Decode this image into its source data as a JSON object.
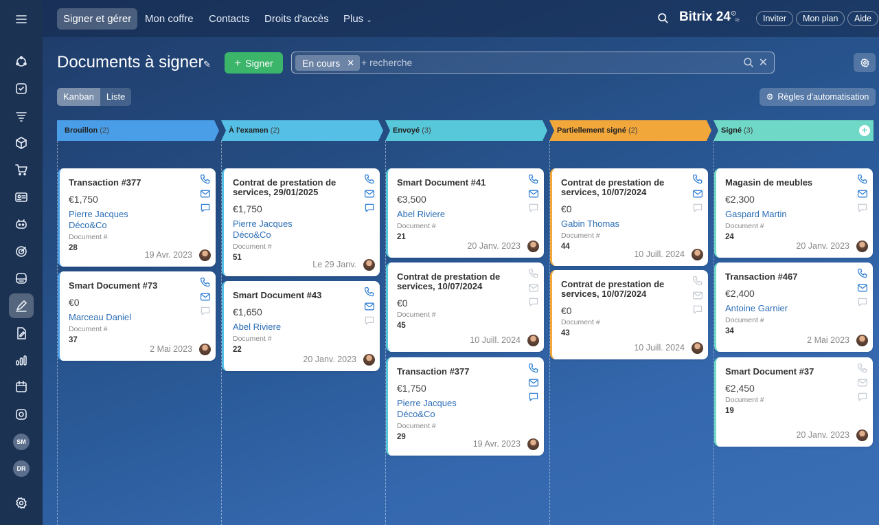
{
  "topnav": {
    "items": [
      "Signer et gérer",
      "Mon coffre",
      "Contacts",
      "Droits d'accès",
      "Plus"
    ],
    "brand": "Bitrix 24",
    "brand_sup": "⊙",
    "invite": "Inviter",
    "plan": "Mon plan",
    "help": "Aide"
  },
  "sidebar": {
    "avatars": [
      "SM",
      "DR"
    ]
  },
  "page": {
    "title": "Documents à signer",
    "sign_button": "Signer",
    "filter_chip": "En cours",
    "search_placeholder": "+ recherche",
    "view_kanban": "Kanban",
    "view_list": "Liste",
    "automation_button": "Règles d'automatisation"
  },
  "columns": [
    {
      "name": "Brouillon",
      "count": "(2)",
      "color": "#4a9ee8"
    },
    {
      "name": "À l'examen",
      "count": "(2)",
      "color": "#55bfe6"
    },
    {
      "name": "Envoyé",
      "count": "(3)",
      "color": "#57c8da"
    },
    {
      "name": "Partiellement signé",
      "count": "(2)",
      "color": "#f2a73b"
    },
    {
      "name": "Signé",
      "count": "(3)",
      "color": "#6fd8c6"
    }
  ],
  "cards": {
    "c0_0": {
      "title": "Transaction #377",
      "amount": "€1,750",
      "link1": "Pierre Jacques",
      "link2": "Déco&Co",
      "meta": "Document #",
      "num": "28",
      "date": "19 Avr. 2023"
    },
    "c0_1": {
      "title": "Smart Document #73",
      "amount": "€0",
      "link1": "Marceau Daniel",
      "meta": "Document #",
      "num": "37",
      "date": "2 Mai 2023"
    },
    "c1_0": {
      "title": "Contrat de prestation de services, 29/01/2025",
      "amount": "€1,750",
      "link1": "Pierre Jacques",
      "link2": "Déco&Co",
      "meta": "Document #",
      "num": "51",
      "date": "Le 29 Janv."
    },
    "c1_1": {
      "title": "Smart Document #43",
      "amount": "€1,650",
      "link1": "Abel Riviere",
      "meta": "Document #",
      "num": "22",
      "date": "20 Janv. 2023"
    },
    "c2_0": {
      "title": "Smart Document #41",
      "amount": "€3,500",
      "link1": "Abel Riviere",
      "meta": "Document #",
      "num": "21",
      "date": "20 Janv. 2023"
    },
    "c2_1": {
      "title": "Contrat de prestation de services, 10/07/2024",
      "amount": "€0",
      "meta": "Document #",
      "num": "45",
      "date": "10 Juill. 2024"
    },
    "c2_2": {
      "title": "Transaction #377",
      "amount": "€1,750",
      "link1": "Pierre Jacques",
      "link2": "Déco&Co",
      "meta": "Document #",
      "num": "29",
      "date": "19 Avr. 2023"
    },
    "c3_0": {
      "title": "Contrat de prestation de services, 10/07/2024",
      "amount": "€0",
      "link1": "Gabin Thomas",
      "meta": "Document #",
      "num": "44",
      "date": "10 Juill. 2024"
    },
    "c3_1": {
      "title": "Contrat de prestation de services, 10/07/2024",
      "amount": "€0",
      "meta": "Document #",
      "num": "43",
      "date": "10 Juill. 2024"
    },
    "c4_0": {
      "title": "Magasin de meubles",
      "amount": "€2,300",
      "link1": "Gaspard Martin",
      "meta": "Document #",
      "num": "24",
      "date": "20 Janv. 2023"
    },
    "c4_1": {
      "title": "Transaction #467",
      "amount": "€2,400",
      "link1": "Antoine Garnier",
      "meta": "Document #",
      "num": "34",
      "date": "2 Mai 2023"
    },
    "c4_2": {
      "title": "Smart Document #37",
      "amount": "€2,450",
      "meta": "Document #",
      "num": "19",
      "date": "20 Janv. 2023"
    }
  }
}
